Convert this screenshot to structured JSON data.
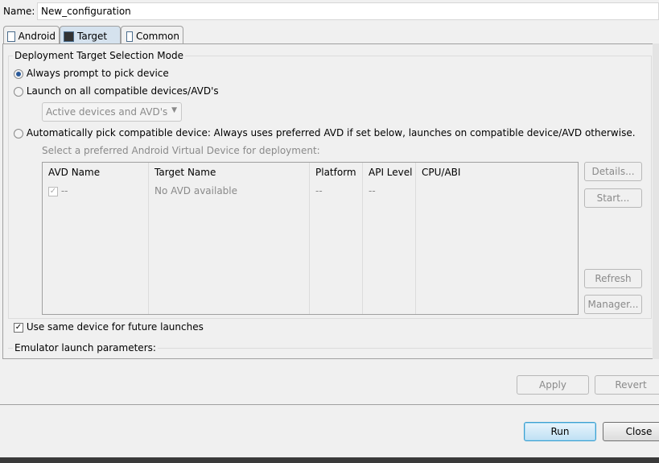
{
  "name": {
    "label": "Name:",
    "value": "New_configuration"
  },
  "tabs": [
    {
      "label": "Android",
      "icon": "document-icon"
    },
    {
      "label": "Target",
      "icon": "device-icon",
      "active": true
    },
    {
      "label": "Common",
      "icon": "table-icon"
    }
  ],
  "mode": {
    "title": "Deployment Target Selection Mode",
    "options": [
      {
        "label": "Always prompt to pick device",
        "selected": true
      },
      {
        "label": "Launch on all compatible devices/AVD's",
        "selected": false
      },
      {
        "label": "Automatically pick compatible device: Always uses preferred AVD if set below, launches on compatible device/AVD otherwise.",
        "selected": false
      }
    ],
    "launch_select": "Active devices and AVD's",
    "avd_prompt": "Select a preferred Android Virtual Device for deployment:"
  },
  "avd_table": {
    "columns": [
      "AVD Name",
      "Target Name",
      "Platform",
      "API Level",
      "CPU/ABI"
    ],
    "rows": [
      [
        "--",
        "No AVD available",
        "--",
        "--",
        ""
      ]
    ]
  },
  "side_buttons": [
    "Details...",
    "Start...",
    "Refresh",
    "Manager..."
  ],
  "same_device": {
    "label": "Use same device for future launches",
    "checked": true
  },
  "emulator": {
    "title": "Emulator launch parameters:"
  },
  "buttons": {
    "apply": "Apply",
    "revert": "Revert",
    "run": "Run",
    "close": "Close"
  }
}
